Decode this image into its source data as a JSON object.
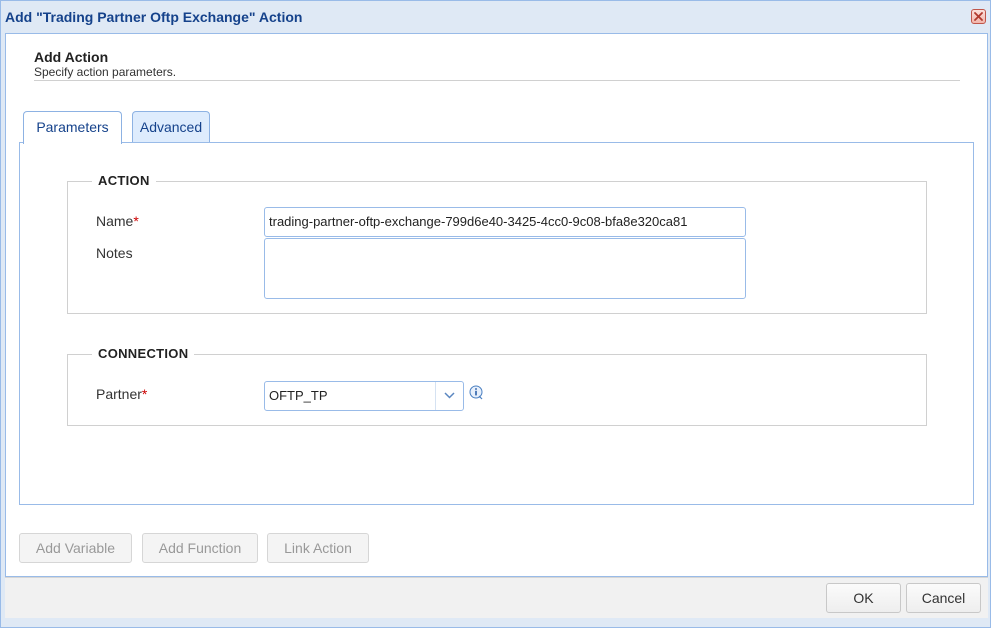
{
  "window": {
    "title": "Add \"Trading Partner Oftp Exchange\" Action",
    "close_icon": "close-icon"
  },
  "header": {
    "title": "Add Action",
    "subtitle": "Specify action parameters."
  },
  "tabs": [
    {
      "label": "Parameters",
      "active": true
    },
    {
      "label": "Advanced",
      "active": false
    }
  ],
  "action_section": {
    "legend": "ACTION",
    "name_label": "Name",
    "required_mark": "*",
    "name_value": "trading-partner-oftp-exchange-799d6e40-3425-4cc0-9c08-bfa8e320ca81",
    "notes_label": "Notes",
    "notes_value": ""
  },
  "connection_section": {
    "legend": "CONNECTION",
    "partner_label": "Partner",
    "required_mark": "*",
    "partner_value": "OFTP_TP",
    "info_icon": "info-icon"
  },
  "actions": {
    "add_variable": "Add Variable",
    "add_function": "Add Function",
    "link_action": "Link Action"
  },
  "footer": {
    "ok": "OK",
    "cancel": "Cancel"
  },
  "colors": {
    "title": "#15428b",
    "border": "#99bbe8",
    "required": "#cc0000"
  }
}
